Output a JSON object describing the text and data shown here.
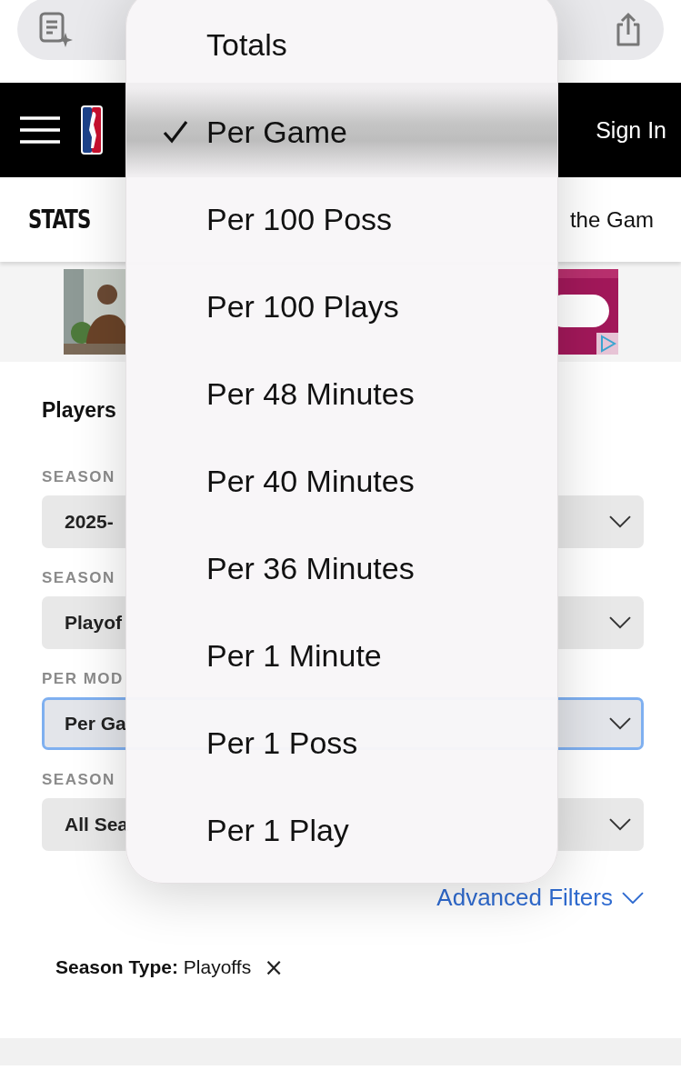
{
  "nav": {
    "sign_in": "Sign In"
  },
  "subnav": {
    "title": "STATS",
    "link": "the Gam"
  },
  "section_title": "Players",
  "filters": [
    {
      "label": "SEASON",
      "value": "2025-",
      "focused": false
    },
    {
      "label": "SEASON",
      "value": "Playof",
      "focused": false
    },
    {
      "label": "PER MOD",
      "value": "Per Ga",
      "focused": true
    },
    {
      "label": "SEASON",
      "value": "All Sea",
      "focused": false
    }
  ],
  "advanced_filters": "Advanced Filters",
  "active_filter": {
    "text": "**Season Type:** Playoffs",
    "remove": "×"
  },
  "menu": [
    {
      "label": "Totals",
      "selected": false
    },
    {
      "label": "Per Game",
      "selected": true
    },
    {
      "label": "Per 100 Poss",
      "selected": false
    },
    {
      "label": "Per 100 Plays",
      "selected": false
    },
    {
      "label": "Per 48 Minutes",
      "selected": false
    },
    {
      "label": "Per 40 Minutes",
      "selected": false
    },
    {
      "label": "Per 36 Minutes",
      "selected": false
    },
    {
      "label": "Per 1 Minute",
      "selected": false
    },
    {
      "label": "Per 1 Poss",
      "selected": false
    },
    {
      "label": "Per 1 Play",
      "selected": false
    }
  ]
}
